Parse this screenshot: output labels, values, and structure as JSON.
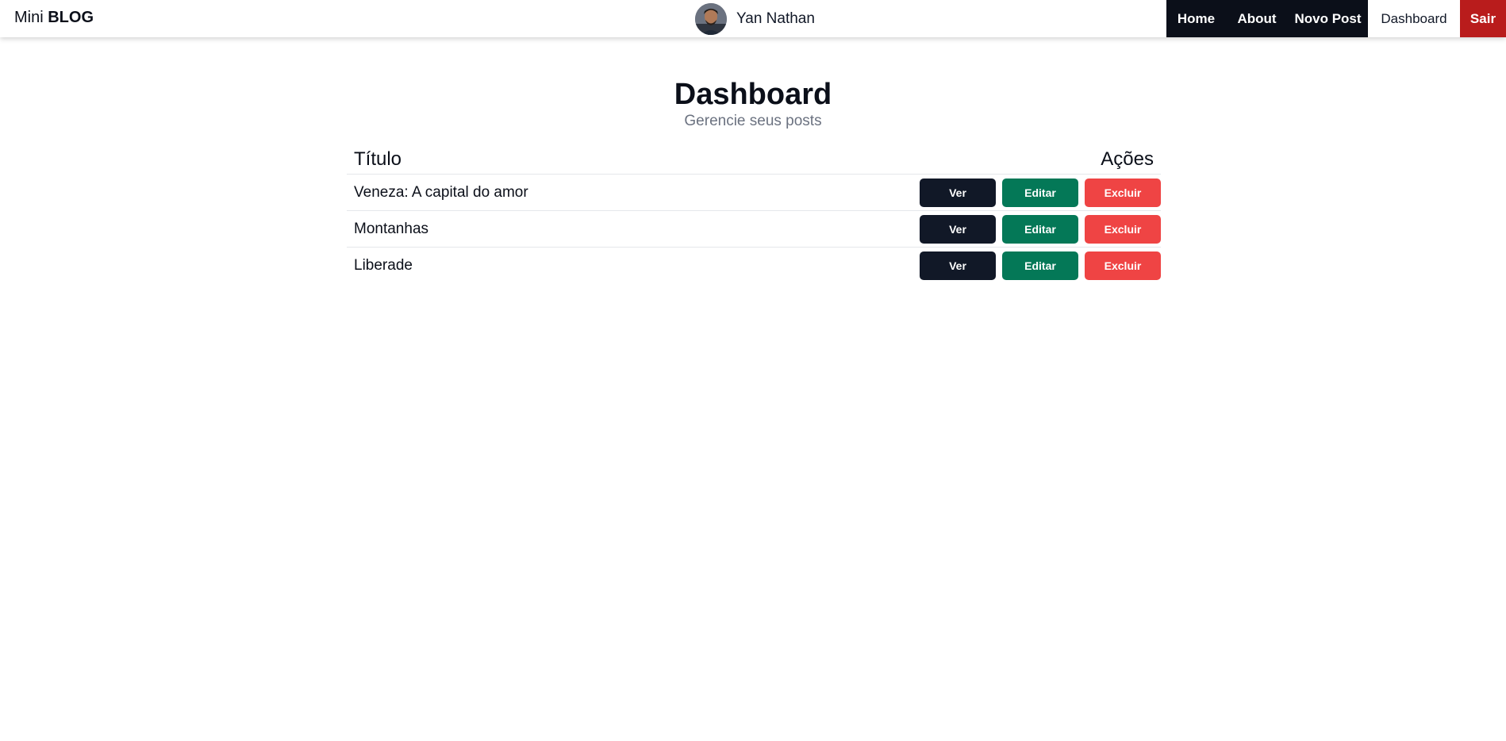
{
  "brand": {
    "prefix": "Mini",
    "bold": "BLOG"
  },
  "user": {
    "name": "Yan Nathan"
  },
  "nav": {
    "home": "Home",
    "about": "About",
    "new_post": "Novo Post",
    "dashboard": "Dashboard",
    "logout": "Sair"
  },
  "page": {
    "title": "Dashboard",
    "subtitle": "Gerencie seus posts"
  },
  "table": {
    "headers": {
      "title": "Título",
      "actions": "Ações"
    },
    "rows": [
      {
        "title": "Veneza: A capital do amor",
        "view": "Ver",
        "edit": "Editar",
        "delete": "Excluir"
      },
      {
        "title": "Montanhas",
        "view": "Ver",
        "edit": "Editar",
        "delete": "Excluir"
      },
      {
        "title": "Liberade",
        "view": "Ver",
        "edit": "Editar",
        "delete": "Excluir"
      }
    ]
  },
  "colors": {
    "nav_dark": "#0b0f19",
    "logout_red": "#b91c1c",
    "btn_view": "#111827",
    "btn_edit": "#047857",
    "btn_delete": "#ef4444"
  }
}
